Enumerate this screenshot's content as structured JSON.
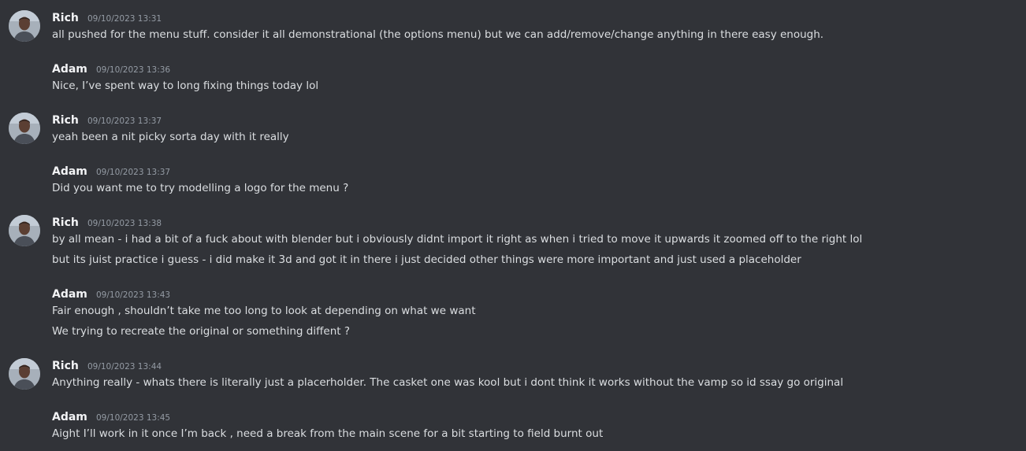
{
  "colors": {
    "background": "#313338",
    "author": "#f2f3f5",
    "timestamp": "#949ba4",
    "message_text": "#dbdee1"
  },
  "messages": [
    {
      "author": "Rich",
      "timestamp": "09/10/2023 13:31",
      "avatar": "rich-avatar",
      "lines": [
        "all pushed for the menu stuff. consider it all demonstrational (the options menu) but we can add/remove/change anything in there easy enough."
      ]
    },
    {
      "author": "Adam",
      "timestamp": "09/10/2023 13:36",
      "lines": [
        "Nice, I’ve spent way to long fixing things today lol"
      ]
    },
    {
      "author": "Rich",
      "timestamp": "09/10/2023 13:37",
      "avatar": "rich-avatar",
      "lines": [
        "yeah been a nit picky sorta day with it really"
      ]
    },
    {
      "author": "Adam",
      "timestamp": "09/10/2023 13:37",
      "lines": [
        "Did you want me to try modelling a logo for the menu ?"
      ]
    },
    {
      "author": "Rich",
      "timestamp": "09/10/2023 13:38",
      "avatar": "rich-avatar",
      "lines": [
        "by all mean - i had a bit of a fuck about with blender but i obviously didnt import it right as when i tried to move it upwards it zoomed off to the right lol",
        "but its juist practice i guess - i did make it 3d and got it in there i just decided other things were more important and just used a placeholder"
      ]
    },
    {
      "author": "Adam",
      "timestamp": "09/10/2023 13:43",
      "lines": [
        "Fair enough , shouldn’t take me too long to look at depending on what we want",
        "We trying to recreate the original or something diffent ?"
      ]
    },
    {
      "author": "Rich",
      "timestamp": "09/10/2023 13:44",
      "avatar": "rich-avatar",
      "lines": [
        "Anything really - whats there is literally just a placerholder. The casket one was kool but i dont think it works without the vamp so id ssay go original"
      ]
    },
    {
      "author": "Adam",
      "timestamp": "09/10/2023 13:45",
      "lines": [
        "Aight I’ll work in it once I’m back , need a break from the main scene for a bit starting to field burnt out"
      ]
    }
  ]
}
